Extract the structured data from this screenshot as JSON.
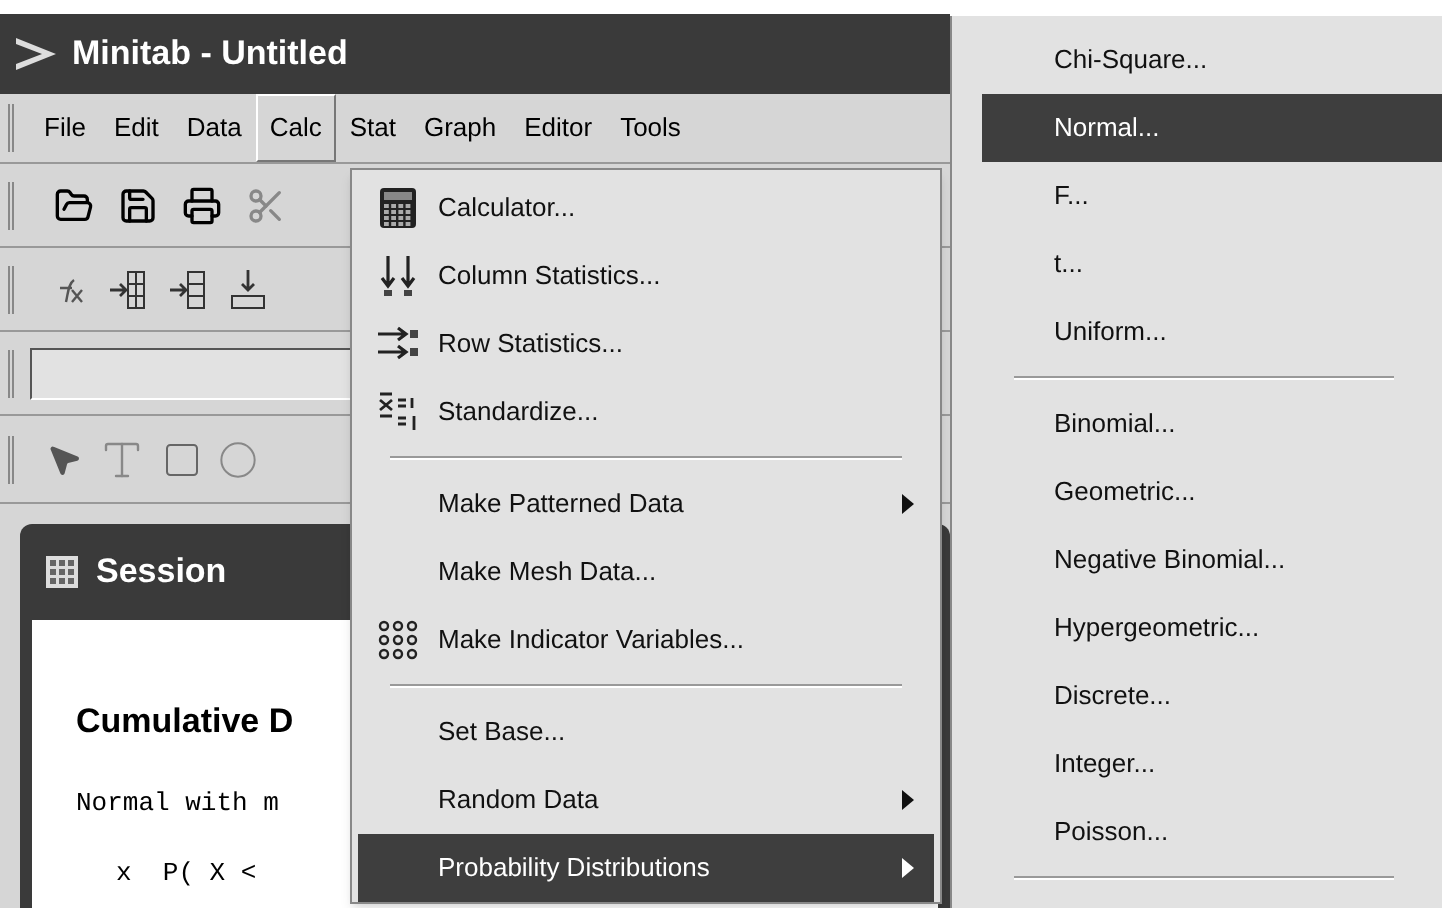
{
  "window": {
    "title": "Minitab - Untitled"
  },
  "menubar": [
    {
      "label": "File",
      "selected": false
    },
    {
      "label": "Edit",
      "selected": false
    },
    {
      "label": "Data",
      "selected": false
    },
    {
      "label": "Calc",
      "selected": true
    },
    {
      "label": "Stat",
      "selected": false
    },
    {
      "label": "Graph",
      "selected": false
    },
    {
      "label": "Editor",
      "selected": false
    },
    {
      "label": "Tools",
      "selected": false
    }
  ],
  "calc_menu": [
    {
      "kind": "item",
      "label": "Calculator...",
      "submenu": false,
      "selected": false
    },
    {
      "kind": "item",
      "label": "Column Statistics...",
      "submenu": false,
      "selected": false
    },
    {
      "kind": "item",
      "label": "Row Statistics...",
      "submenu": false,
      "selected": false
    },
    {
      "kind": "item",
      "label": "Standardize...",
      "submenu": false,
      "selected": false
    },
    {
      "kind": "separator"
    },
    {
      "kind": "item",
      "label": "Make Patterned Data",
      "submenu": true,
      "selected": false
    },
    {
      "kind": "item",
      "label": "Make Mesh Data...",
      "submenu": false,
      "selected": false
    },
    {
      "kind": "item",
      "label": "Make Indicator Variables...",
      "submenu": false,
      "selected": false
    },
    {
      "kind": "separator"
    },
    {
      "kind": "item",
      "label": "Set Base...",
      "submenu": false,
      "selected": false
    },
    {
      "kind": "item",
      "label": "Random Data",
      "submenu": true,
      "selected": false
    },
    {
      "kind": "item",
      "label": "Probability Distributions",
      "submenu": true,
      "selected": true
    }
  ],
  "distributions_menu": [
    {
      "kind": "item",
      "label": "Chi-Square...",
      "selected": false
    },
    {
      "kind": "item",
      "label": "Normal...",
      "selected": true
    },
    {
      "kind": "item",
      "label": "F...",
      "selected": false
    },
    {
      "kind": "item",
      "label": "t...",
      "selected": false
    },
    {
      "kind": "item",
      "label": "Uniform...",
      "selected": false
    },
    {
      "kind": "separator"
    },
    {
      "kind": "item",
      "label": "Binomial...",
      "selected": false
    },
    {
      "kind": "item",
      "label": "Geometric...",
      "selected": false
    },
    {
      "kind": "item",
      "label": "Negative Binomial...",
      "selected": false
    },
    {
      "kind": "item",
      "label": "Hypergeometric...",
      "selected": false
    },
    {
      "kind": "item",
      "label": "Discrete...",
      "selected": false
    },
    {
      "kind": "item",
      "label": "Integer...",
      "selected": false
    },
    {
      "kind": "item",
      "label": "Poisson...",
      "selected": false
    },
    {
      "kind": "separator"
    }
  ],
  "session": {
    "title": "Session",
    "heading": "Cumulative D",
    "lines": [
      "Normal with m",
      "x  P( X <"
    ]
  }
}
